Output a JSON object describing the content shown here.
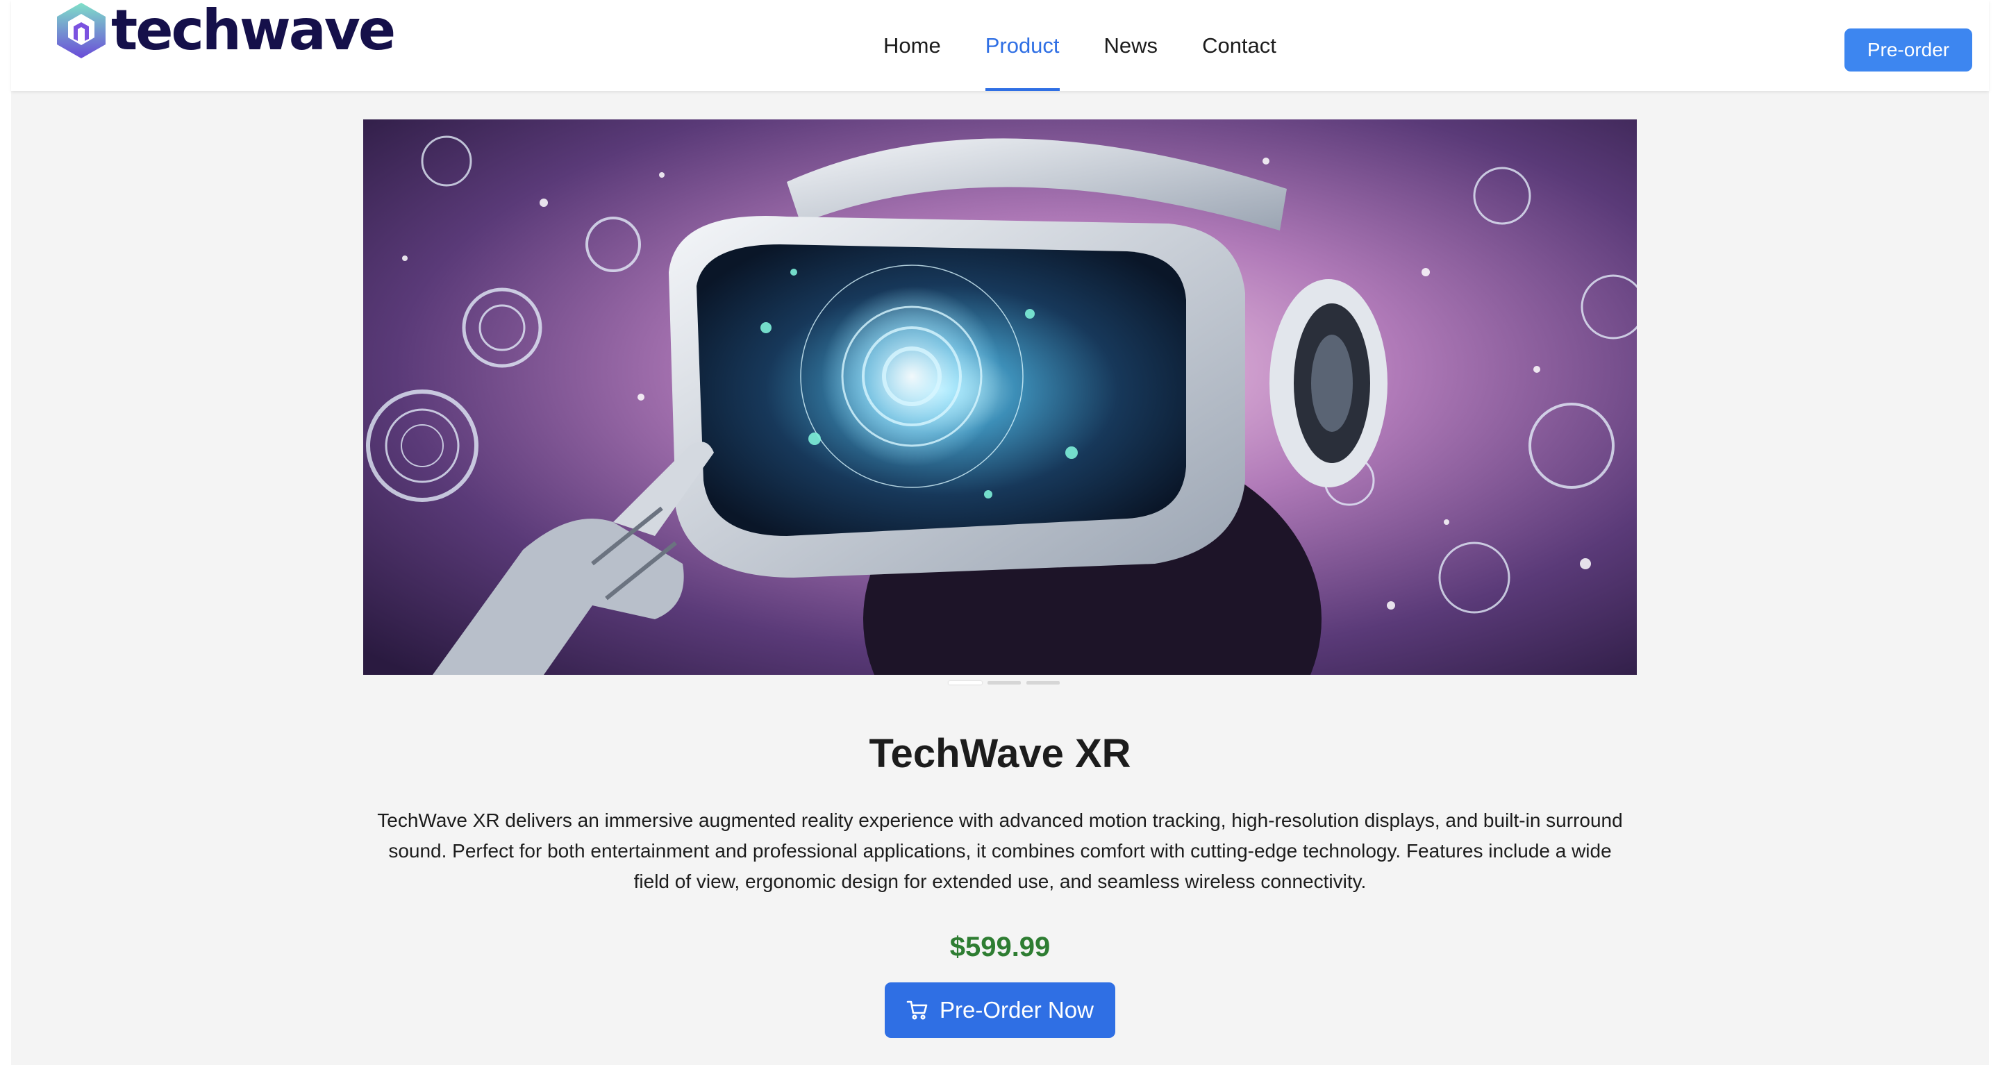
{
  "brand": {
    "name": "techwave",
    "logo_icon": "hexagon-cube-icon"
  },
  "nav": {
    "items": [
      {
        "label": "Home",
        "active": false
      },
      {
        "label": "Product",
        "active": true
      },
      {
        "label": "News",
        "active": false
      },
      {
        "label": "Contact",
        "active": false
      }
    ]
  },
  "header": {
    "preorder_label": "Pre-order"
  },
  "hero": {
    "image": "vr-headset-futuristic-illustration",
    "slides": 3,
    "active_slide": 1
  },
  "product": {
    "title": "TechWave XR",
    "description": "TechWave XR delivers an immersive augmented reality experience with advanced motion tracking, high-resolution displays, and built-in surround sound. Perfect for both entertainment and professional applications, it combines comfort with cutting-edge technology. Features include a wide field of view, ergonomic design for extended use, and seamless wireless connectivity.",
    "price": "$599.99",
    "cta_label": "Pre-Order Now",
    "cta_icon": "shopping-cart-icon"
  },
  "colors": {
    "accent": "#2f6fe4",
    "header_button": "#3d86f0",
    "price": "#2e7d32",
    "brand_text": "#15104a"
  }
}
